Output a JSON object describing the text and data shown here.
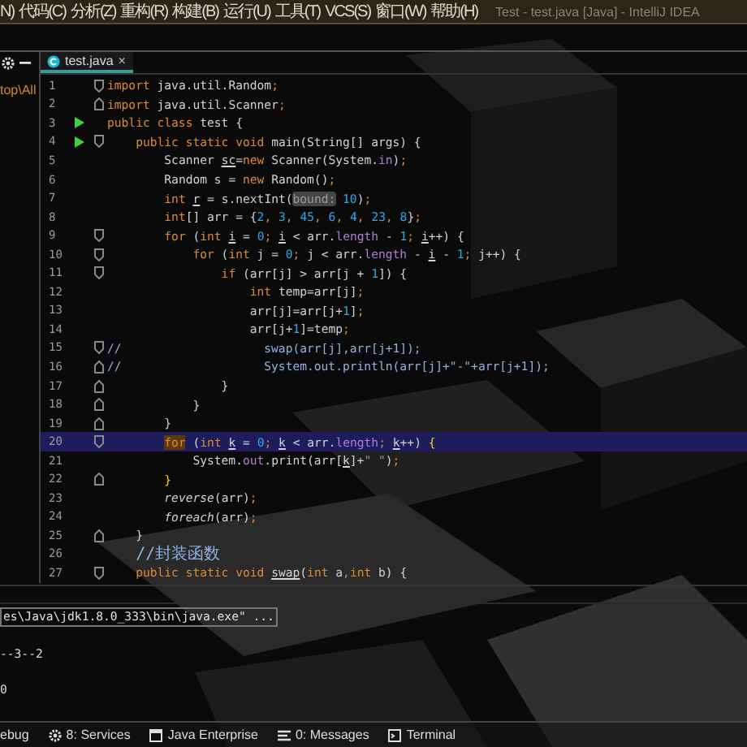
{
  "menu_bar": {
    "items": [
      "N)",
      "代码(C)",
      "分析(Z)",
      "重构(R)",
      "构建(B)",
      "运行(U)",
      "工具(T)",
      "VCS(S)",
      "窗口(W)",
      "帮助(H)"
    ],
    "title": "Test - test.java [Java] - IntelliJ IDEA"
  },
  "project_panel": {
    "path_fragment": "top\\All"
  },
  "tabs": [
    {
      "label": "test.java",
      "close": "×",
      "selected": true
    }
  ],
  "lines": [
    {
      "number": "1",
      "fold_start": true,
      "fold_end": false,
      "run": false,
      "selected": false,
      "tokens": [
        {
          "kind": "kw",
          "text": "import "
        },
        {
          "kind": "plain",
          "text": "java.util.Random"
        },
        {
          "kind": "kw",
          "text": ";"
        }
      ]
    },
    {
      "number": "2",
      "fold_start": false,
      "fold_end": true,
      "run": false,
      "selected": false,
      "tokens": [
        {
          "kind": "kw",
          "text": "import "
        },
        {
          "kind": "plain",
          "text": "java.util.Scanner"
        },
        {
          "kind": "kw",
          "text": ";"
        }
      ]
    },
    {
      "number": "3",
      "fold_start": false,
      "fold_end": false,
      "run": true,
      "selected": false,
      "tokens": [
        {
          "kind": "kw",
          "text": "public class "
        },
        {
          "kind": "plain",
          "text": "test {"
        }
      ]
    },
    {
      "number": "4",
      "fold_start": true,
      "fold_end": false,
      "run": true,
      "selected": false,
      "tokens": [
        {
          "kind": "kw",
          "text": "    public static void "
        },
        {
          "kind": "plain",
          "text": "main(String[] args) {"
        }
      ]
    },
    {
      "number": "5",
      "fold_start": false,
      "fold_end": false,
      "run": false,
      "selected": false,
      "tokens": [
        {
          "kind": "plain",
          "text": "        Scanner "
        },
        {
          "kind": "under",
          "text": "sc"
        },
        {
          "kind": "plain",
          "text": "="
        },
        {
          "kind": "kw",
          "text": "new "
        },
        {
          "kind": "plain",
          "text": "Scanner(System."
        },
        {
          "kind": "field",
          "text": "in"
        },
        {
          "kind": "plain",
          "text": ")"
        },
        {
          "kind": "kw",
          "text": ";"
        }
      ]
    },
    {
      "number": "6",
      "fold_start": false,
      "fold_end": false,
      "run": false,
      "selected": false,
      "tokens": [
        {
          "kind": "plain",
          "text": "        Random s = "
        },
        {
          "kind": "kw",
          "text": "new "
        },
        {
          "kind": "plain",
          "text": "Random()"
        },
        {
          "kind": "kw",
          "text": ";"
        }
      ]
    },
    {
      "number": "7",
      "fold_start": false,
      "fold_end": false,
      "run": false,
      "selected": false,
      "tokens": [
        {
          "kind": "kw",
          "text": "        int "
        },
        {
          "kind": "under",
          "text": "r"
        },
        {
          "kind": "plain",
          "text": " = s.nextInt("
        },
        {
          "kind": "hint",
          "text": "bound:"
        },
        {
          "kind": "num",
          "text": " 10"
        },
        {
          "kind": "plain",
          "text": ")"
        },
        {
          "kind": "kw",
          "text": ";"
        }
      ]
    },
    {
      "number": "8",
      "fold_start": false,
      "fold_end": false,
      "run": false,
      "selected": false,
      "tokens": [
        {
          "kind": "kw",
          "text": "        int"
        },
        {
          "kind": "plain",
          "text": "[] arr = {"
        },
        {
          "kind": "num",
          "text": "2"
        },
        {
          "kind": "kw",
          "text": ", "
        },
        {
          "kind": "num",
          "text": "3"
        },
        {
          "kind": "kw",
          "text": ", "
        },
        {
          "kind": "num",
          "text": "45"
        },
        {
          "kind": "kw",
          "text": ", "
        },
        {
          "kind": "num",
          "text": "6"
        },
        {
          "kind": "kw",
          "text": ", "
        },
        {
          "kind": "num",
          "text": "4"
        },
        {
          "kind": "kw",
          "text": ", "
        },
        {
          "kind": "num",
          "text": "23"
        },
        {
          "kind": "kw",
          "text": ", "
        },
        {
          "kind": "num",
          "text": "8"
        },
        {
          "kind": "plain",
          "text": "}"
        },
        {
          "kind": "kw",
          "text": ";"
        }
      ]
    },
    {
      "number": "9",
      "fold_start": true,
      "fold_end": false,
      "run": false,
      "selected": false,
      "tokens": [
        {
          "kind": "kw",
          "text": "        for "
        },
        {
          "kind": "plain",
          "text": "("
        },
        {
          "kind": "kw",
          "text": "int "
        },
        {
          "kind": "under",
          "text": "i"
        },
        {
          "kind": "plain",
          "text": " = "
        },
        {
          "kind": "num",
          "text": "0"
        },
        {
          "kind": "kw",
          "text": "; "
        },
        {
          "kind": "under",
          "text": "i"
        },
        {
          "kind": "plain",
          "text": " < arr."
        },
        {
          "kind": "field",
          "text": "length"
        },
        {
          "kind": "plain",
          "text": " - "
        },
        {
          "kind": "num",
          "text": "1"
        },
        {
          "kind": "kw",
          "text": "; "
        },
        {
          "kind": "under",
          "text": "i"
        },
        {
          "kind": "plain",
          "text": "++) {"
        }
      ]
    },
    {
      "number": "10",
      "fold_start": true,
      "fold_end": false,
      "run": false,
      "selected": false,
      "tokens": [
        {
          "kind": "kw",
          "text": "            for "
        },
        {
          "kind": "plain",
          "text": "("
        },
        {
          "kind": "kw",
          "text": "int "
        },
        {
          "kind": "plain",
          "text": "j = "
        },
        {
          "kind": "num",
          "text": "0"
        },
        {
          "kind": "kw",
          "text": "; "
        },
        {
          "kind": "plain",
          "text": "j < arr."
        },
        {
          "kind": "field",
          "text": "length"
        },
        {
          "kind": "plain",
          "text": " - "
        },
        {
          "kind": "under",
          "text": "i"
        },
        {
          "kind": "plain",
          "text": " - "
        },
        {
          "kind": "num",
          "text": "1"
        },
        {
          "kind": "kw",
          "text": "; "
        },
        {
          "kind": "plain",
          "text": "j++) {"
        }
      ]
    },
    {
      "number": "11",
      "fold_start": true,
      "fold_end": false,
      "run": false,
      "selected": false,
      "tokens": [
        {
          "kind": "kw",
          "text": "                if "
        },
        {
          "kind": "plain",
          "text": "(arr[j] > arr[j + "
        },
        {
          "kind": "num",
          "text": "1"
        },
        {
          "kind": "plain",
          "text": "]) {"
        }
      ]
    },
    {
      "number": "12",
      "fold_start": false,
      "fold_end": false,
      "run": false,
      "selected": false,
      "tokens": [
        {
          "kind": "kw",
          "text": "                    int "
        },
        {
          "kind": "plain",
          "text": "temp=arr[j]"
        },
        {
          "kind": "kw",
          "text": ";"
        }
      ]
    },
    {
      "number": "13",
      "fold_start": false,
      "fold_end": false,
      "run": false,
      "selected": false,
      "tokens": [
        {
          "kind": "plain",
          "text": "                    arr[j]=arr[j+"
        },
        {
          "kind": "num",
          "text": "1"
        },
        {
          "kind": "plain",
          "text": "]"
        },
        {
          "kind": "kw",
          "text": ";"
        }
      ]
    },
    {
      "number": "14",
      "fold_start": false,
      "fold_end": false,
      "run": false,
      "selected": false,
      "tokens": [
        {
          "kind": "plain",
          "text": "                    arr[j+"
        },
        {
          "kind": "num",
          "text": "1"
        },
        {
          "kind": "plain",
          "text": "]=temp"
        },
        {
          "kind": "kw",
          "text": ";"
        }
      ]
    },
    {
      "number": "15",
      "fold_start": true,
      "fold_end": false,
      "run": false,
      "selected": false,
      "tokens": [
        {
          "kind": "comment",
          "text": "//                    swap(arr[j],arr[j+1]);"
        }
      ]
    },
    {
      "number": "16",
      "fold_start": false,
      "fold_end": true,
      "run": false,
      "selected": false,
      "tokens": [
        {
          "kind": "comment",
          "text": "//                    System.out.println(arr[j]+\"-\"+arr[j+1]);"
        }
      ]
    },
    {
      "number": "17",
      "fold_start": false,
      "fold_end": true,
      "run": false,
      "selected": false,
      "tokens": [
        {
          "kind": "plain",
          "text": "                }"
        }
      ]
    },
    {
      "number": "18",
      "fold_start": false,
      "fold_end": true,
      "run": false,
      "selected": false,
      "tokens": [
        {
          "kind": "plain",
          "text": "            }"
        }
      ]
    },
    {
      "number": "19",
      "fold_start": false,
      "fold_end": true,
      "run": false,
      "selected": false,
      "tokens": [
        {
          "kind": "plain",
          "text": "        }"
        }
      ]
    },
    {
      "number": "20",
      "fold_start": true,
      "fold_end": false,
      "run": false,
      "selected": true,
      "tokens": [
        {
          "kind": "kwmark",
          "text": "        for"
        },
        {
          "kind": "plain",
          "text": " ("
        },
        {
          "kind": "kw",
          "text": "int "
        },
        {
          "kind": "under",
          "text": "k"
        },
        {
          "kind": "plain",
          "text": " = "
        },
        {
          "kind": "num",
          "text": "0"
        },
        {
          "kind": "kw",
          "text": "; "
        },
        {
          "kind": "under",
          "text": "k"
        },
        {
          "kind": "plain",
          "text": " < arr."
        },
        {
          "kind": "field",
          "text": "length"
        },
        {
          "kind": "kw",
          "text": "; "
        },
        {
          "kind": "under",
          "text": "k"
        },
        {
          "kind": "plain",
          "text": "++) "
        },
        {
          "kind": "brace",
          "text": "{"
        }
      ]
    },
    {
      "number": "21",
      "fold_start": false,
      "fold_end": false,
      "run": false,
      "selected": false,
      "tokens": [
        {
          "kind": "plain",
          "text": "            System."
        },
        {
          "kind": "field",
          "text": "out"
        },
        {
          "kind": "plain",
          "text": ".print(arr["
        },
        {
          "kind": "under",
          "text": "k"
        },
        {
          "kind": "plain",
          "text": "]+"
        },
        {
          "kind": "str",
          "text": "\" \""
        },
        {
          "kind": "plain",
          "text": ")"
        },
        {
          "kind": "kw",
          "text": ";"
        }
      ]
    },
    {
      "number": "22",
      "fold_start": false,
      "fold_end": true,
      "run": false,
      "selected": false,
      "tokens": [
        {
          "kind": "brace",
          "text": "        }"
        }
      ]
    },
    {
      "number": "23",
      "fold_start": false,
      "fold_end": false,
      "run": false,
      "selected": false,
      "tokens": [
        {
          "kind": "italic",
          "text": "        reverse"
        },
        {
          "kind": "plain",
          "text": "(arr)"
        },
        {
          "kind": "kw",
          "text": ";"
        }
      ]
    },
    {
      "number": "24",
      "fold_start": false,
      "fold_end": false,
      "run": false,
      "selected": false,
      "tokens": [
        {
          "kind": "italic",
          "text": "        foreach"
        },
        {
          "kind": "plain",
          "text": "(arr)"
        },
        {
          "kind": "kw",
          "text": ";"
        }
      ]
    },
    {
      "number": "25",
      "fold_start": false,
      "fold_end": true,
      "run": false,
      "selected": false,
      "tokens": [
        {
          "kind": "plain",
          "text": "    }"
        }
      ]
    },
    {
      "number": "26",
      "fold_start": false,
      "fold_end": false,
      "run": false,
      "selected": false,
      "tokens": [
        {
          "kind": "comment",
          "text": "    //封装函数"
        }
      ]
    },
    {
      "number": "27",
      "fold_start": true,
      "fold_end": false,
      "run": false,
      "selected": false,
      "tokens": [
        {
          "kind": "kw",
          "text": "    public static void "
        },
        {
          "kind": "under",
          "text": "swap"
        },
        {
          "kind": "plain",
          "text": "("
        },
        {
          "kind": "kw",
          "text": "int "
        },
        {
          "kind": "plain",
          "text": "a"
        },
        {
          "kind": "kw",
          "text": ","
        },
        {
          "kind": "kw",
          "text": "int "
        },
        {
          "kind": "plain",
          "text": "b) {"
        }
      ]
    }
  ],
  "console": {
    "command": "es\\Java\\jdk1.8.0_333\\bin\\java.exe\" ...",
    "output": [
      "--3--2",
      "0"
    ]
  },
  "tool_windows": [
    {
      "label": "ebug",
      "kind": "plain"
    },
    {
      "label": "8: Services",
      "kind": "gear"
    },
    {
      "label": "Java Enterprise",
      "kind": "window"
    },
    {
      "label": "0: Messages",
      "kind": "list"
    },
    {
      "label": "Terminal",
      "kind": "terminal"
    }
  ]
}
